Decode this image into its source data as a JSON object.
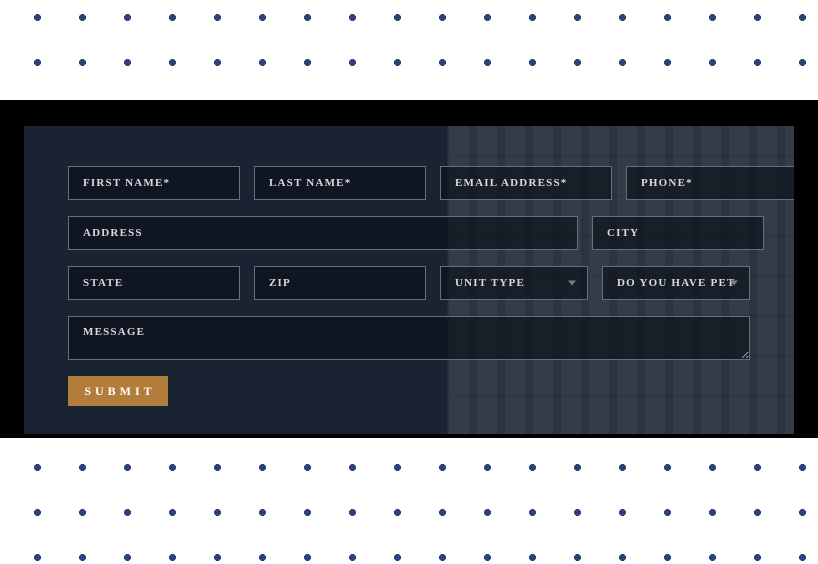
{
  "form": {
    "first_name": {
      "placeholder": "FIRST NAME*",
      "value": ""
    },
    "last_name": {
      "placeholder": "LAST NAME*",
      "value": ""
    },
    "email": {
      "placeholder": "EMAIL ADDRESS*",
      "value": ""
    },
    "phone": {
      "placeholder": "PHONE*",
      "value": ""
    },
    "address": {
      "placeholder": "ADDRESS",
      "value": ""
    },
    "city": {
      "placeholder": "CITY",
      "value": ""
    },
    "state": {
      "placeholder": "STATE",
      "value": ""
    },
    "zip": {
      "placeholder": "ZIP",
      "value": ""
    },
    "unit_type": {
      "label": "UNIT TYPE"
    },
    "pets": {
      "label": "DO YOU HAVE PETS?"
    },
    "message": {
      "placeholder": "MESSAGE",
      "value": ""
    },
    "submit_label": "SUBMIT"
  }
}
